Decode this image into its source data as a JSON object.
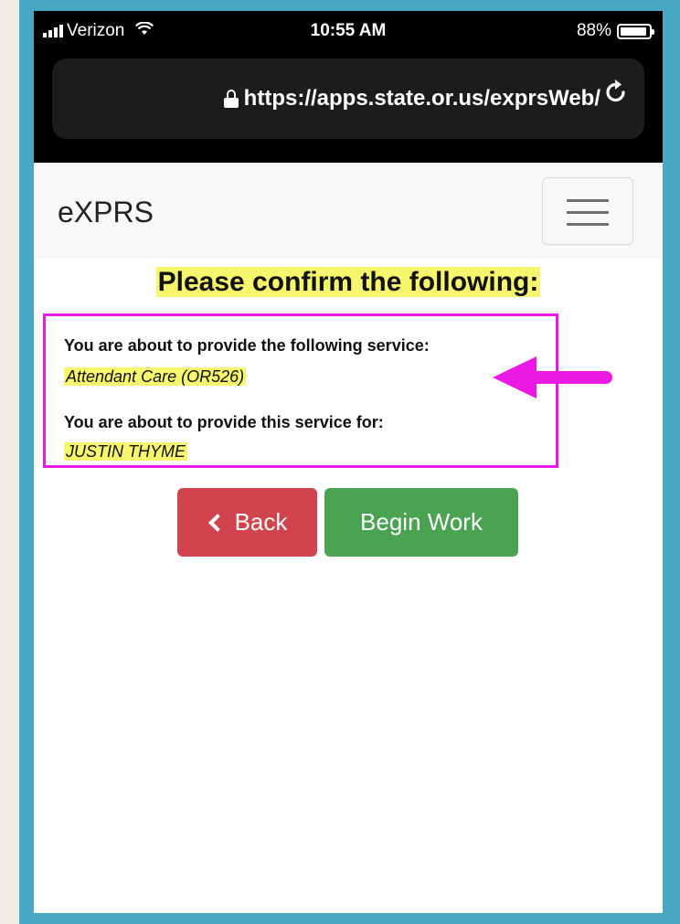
{
  "status_bar": {
    "carrier": "Verizon",
    "time": "10:55 AM",
    "battery": "88%"
  },
  "browser": {
    "url": "https://apps.state.or.us/exprsWeb/",
    "icons": [
      "lock-icon",
      "reload-icon"
    ]
  },
  "navbar": {
    "brand": "eXPRS",
    "menu_icon": "hamburger-icon"
  },
  "main": {
    "heading": "Please confirm the following:",
    "service_label": "You are about to provide the following service:",
    "service_value": "Attendant Care (OR526)",
    "client_label": "You are about to provide this service for:",
    "client_value": "JUSTIN THYME"
  },
  "buttons": {
    "back": "Back",
    "begin": "Begin Work"
  },
  "annotation": {
    "icon": "arrow-left-icon",
    "color": "#ea19e4"
  },
  "colors": {
    "highlight": "#f7f76e",
    "back_button": "#d1444e",
    "begin_button": "#4aa351",
    "frame": "#49a9c3"
  }
}
